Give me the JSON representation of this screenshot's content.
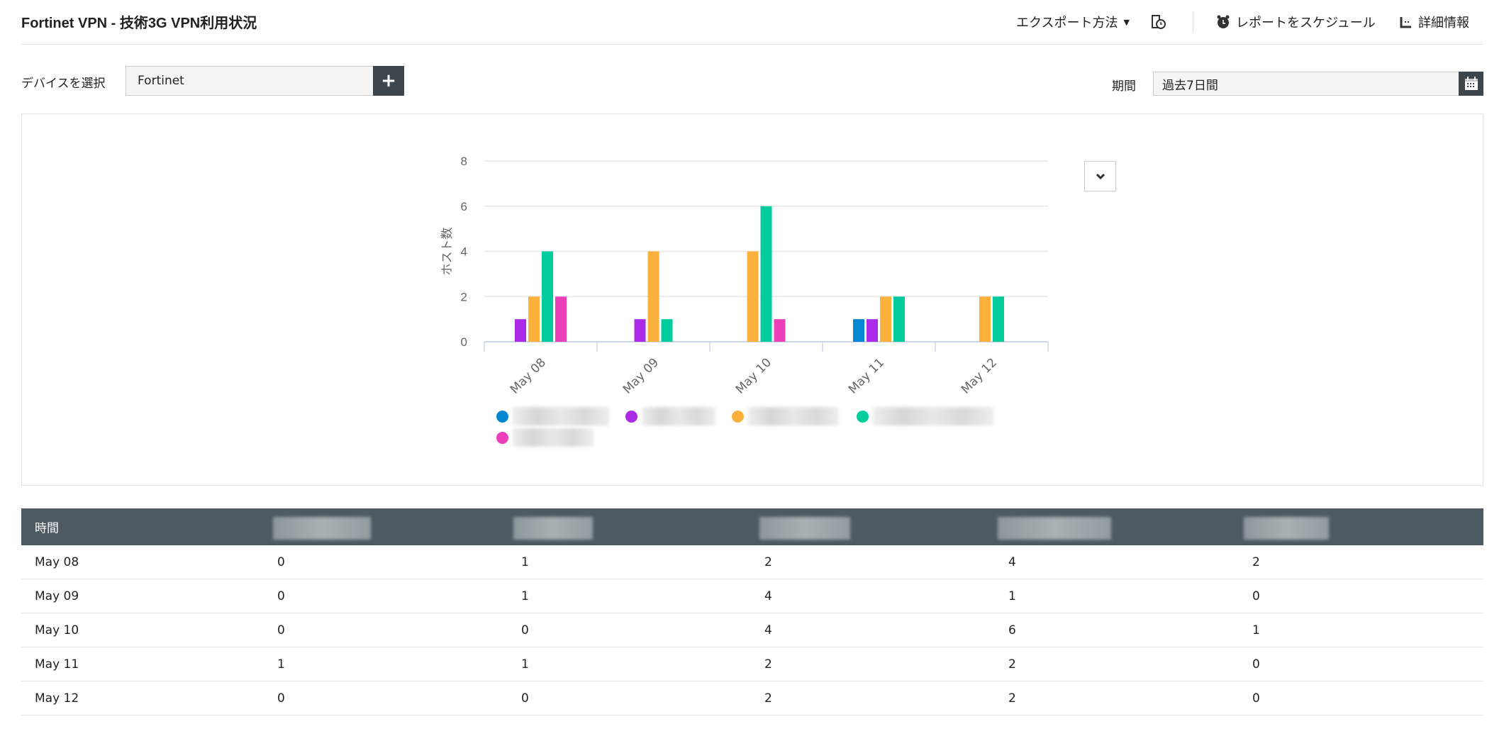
{
  "header": {
    "title": "Fortinet VPN - 技術3G VPN利用状況",
    "export_label": "エクスポート方法",
    "schedule_label": "レポートをスケジュール",
    "details_label": "詳細情報"
  },
  "filters": {
    "device_label": "デバイスを選択",
    "device_value": "Fortinet",
    "period_label": "期間",
    "period_value": "過去7日間"
  },
  "table": {
    "time_header": "時間",
    "rows": [
      {
        "time": "May 08",
        "values": [
          "0",
          "1",
          "2",
          "4",
          "2"
        ]
      },
      {
        "time": "May 09",
        "values": [
          "0",
          "1",
          "4",
          "1",
          "0"
        ]
      },
      {
        "time": "May 10",
        "values": [
          "0",
          "0",
          "4",
          "6",
          "1"
        ]
      },
      {
        "time": "May 11",
        "values": [
          "1",
          "1",
          "2",
          "2",
          "0"
        ]
      },
      {
        "time": "May 12",
        "values": [
          "0",
          "0",
          "2",
          "2",
          "0"
        ]
      }
    ]
  },
  "chart_data": {
    "type": "bar",
    "title": "",
    "xlabel": "",
    "ylabel": "ホスト数",
    "ylim": [
      0,
      8
    ],
    "yticks": [
      "0",
      "2",
      "4",
      "6",
      "8"
    ],
    "categories": [
      "May 08",
      "May 09",
      "May 10",
      "May 11",
      "May 12"
    ],
    "series": [
      {
        "name": "",
        "color": "#0288d1",
        "values": [
          0,
          0,
          0,
          1,
          0
        ]
      },
      {
        "name": "",
        "color": "#aa2ae8",
        "values": [
          1,
          1,
          0,
          1,
          0
        ]
      },
      {
        "name": "",
        "color": "#fbb13c",
        "values": [
          2,
          4,
          4,
          2,
          2
        ]
      },
      {
        "name": "",
        "color": "#00cc9e",
        "values": [
          4,
          1,
          6,
          2,
          2
        ]
      },
      {
        "name": "",
        "color": "#ee3fbb",
        "values": [
          2,
          0,
          1,
          0,
          0
        ]
      }
    ],
    "legend": "bottom",
    "grid": true
  }
}
